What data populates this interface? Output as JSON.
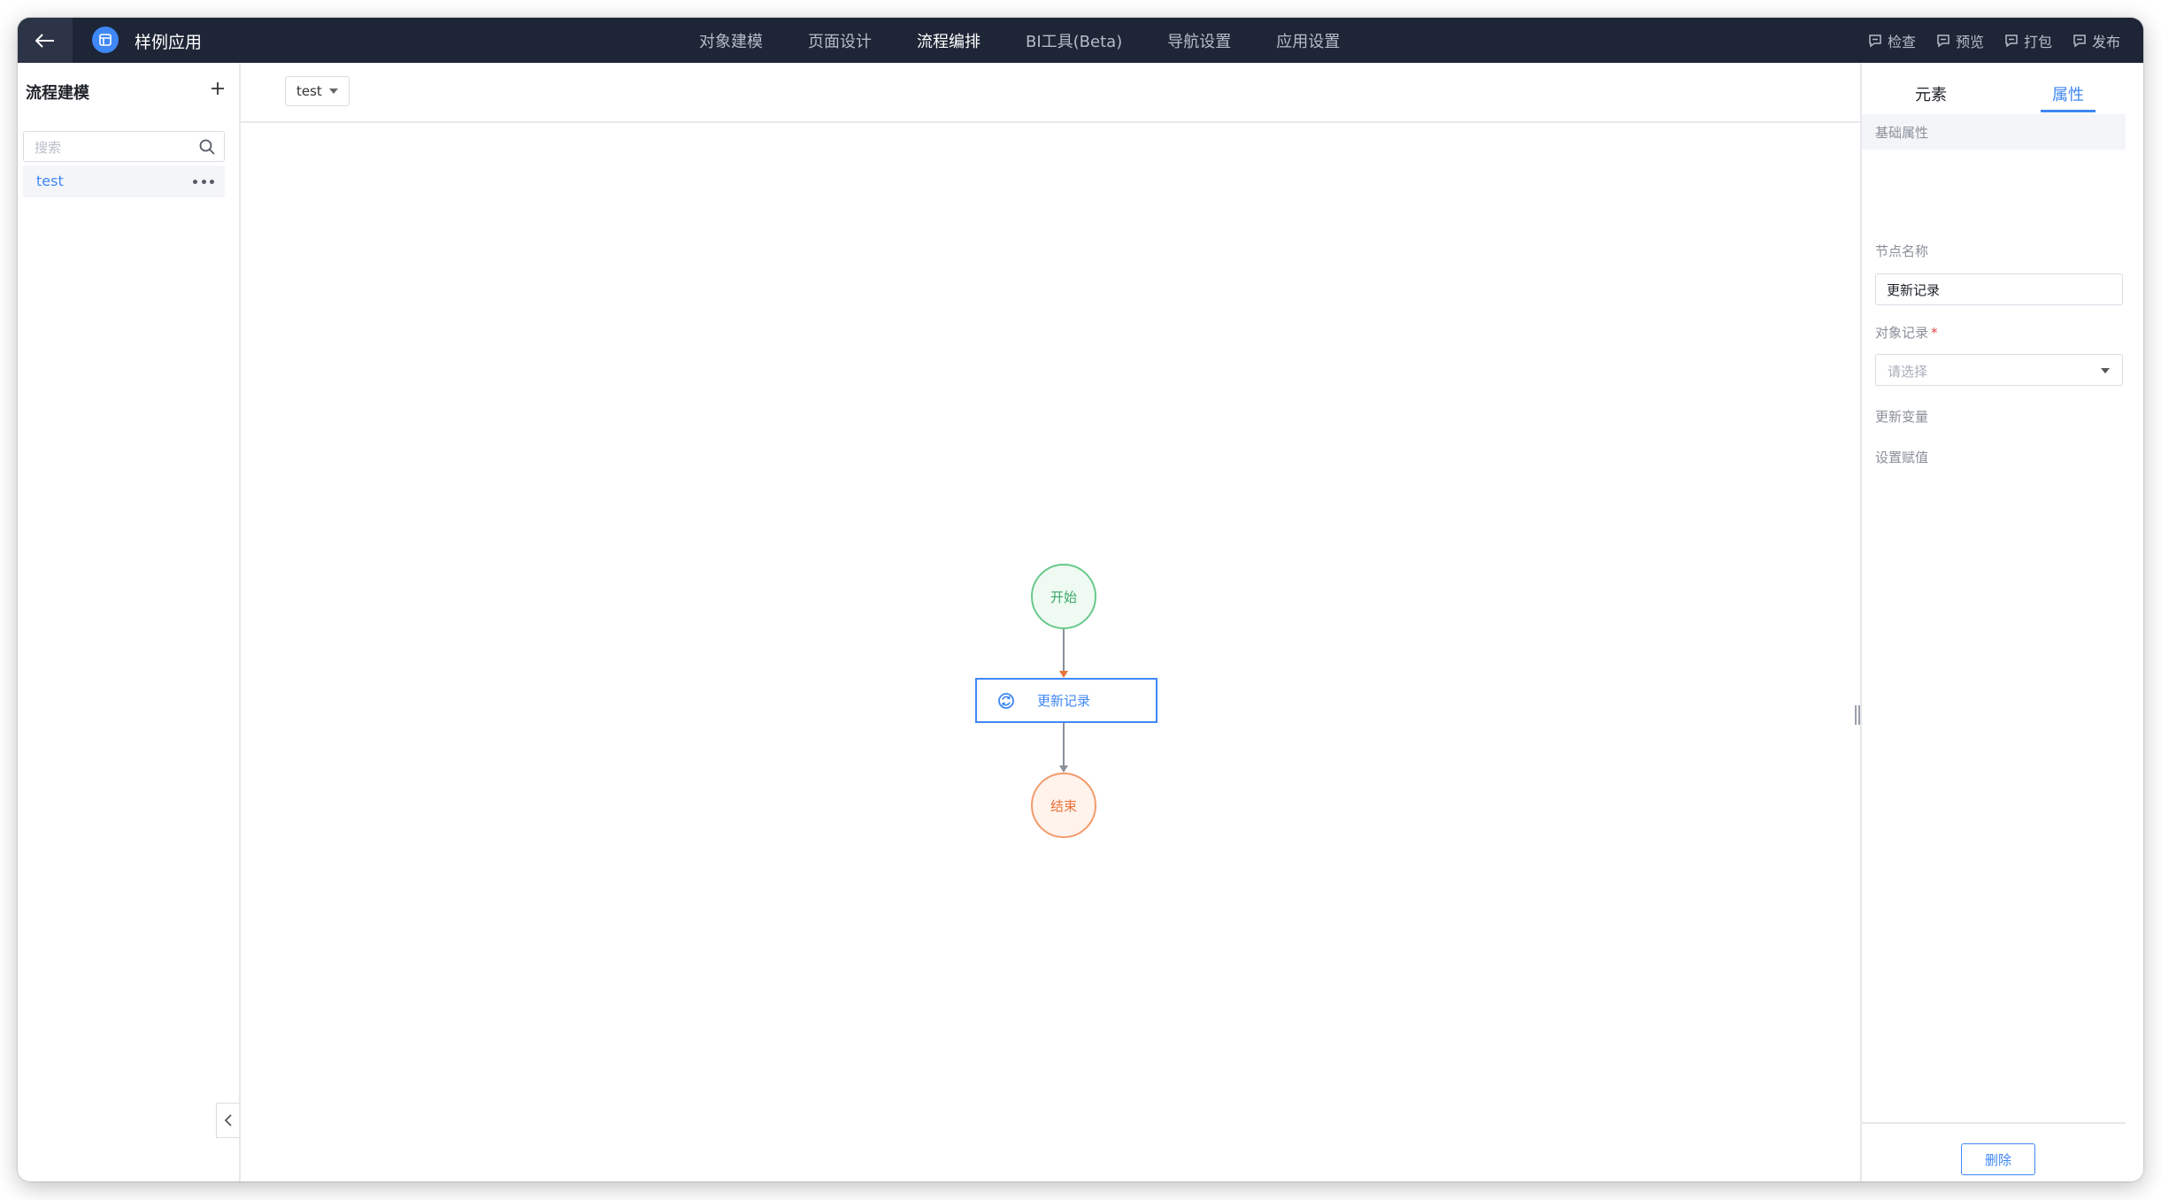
{
  "app": {
    "name": "样例应用"
  },
  "nav": {
    "items": [
      {
        "label": "对象建模",
        "active": false
      },
      {
        "label": "页面设计",
        "active": false
      },
      {
        "label": "流程编排",
        "active": true
      },
      {
        "label": "BI工具(Beta)",
        "active": false
      },
      {
        "label": "导航设置",
        "active": false
      },
      {
        "label": "应用设置",
        "active": false
      }
    ]
  },
  "tools": [
    {
      "label": "检查",
      "icon": "check-icon"
    },
    {
      "label": "预览",
      "icon": "preview-icon"
    },
    {
      "label": "打包",
      "icon": "package-icon"
    },
    {
      "label": "发布",
      "icon": "publish-icon"
    }
  ],
  "sidebar": {
    "title": "流程建模",
    "search_placeholder": "搜索",
    "items": [
      {
        "label": "test",
        "selected": true
      }
    ]
  },
  "toolbar": {
    "flow_select_value": "test"
  },
  "canvas": {
    "nodes": {
      "start": "开始",
      "update": "更新记录",
      "end": "结束"
    }
  },
  "panel": {
    "tabs": {
      "elements": "元素",
      "properties": "属性",
      "active": "属性"
    },
    "section": "基础属性",
    "node_name_label": "节点名称",
    "node_name_value": "更新记录",
    "object_record_label": "对象记录",
    "object_record_required": "*",
    "object_record_placeholder": "请选择",
    "update_variable_label": "更新变量",
    "assign_value_label": "设置赋值",
    "delete_label": "删除"
  },
  "colors": {
    "topbar": "#1e2536",
    "accent": "#3f87f5",
    "start_node": "#69c98a",
    "end_node": "#f29a6b"
  }
}
